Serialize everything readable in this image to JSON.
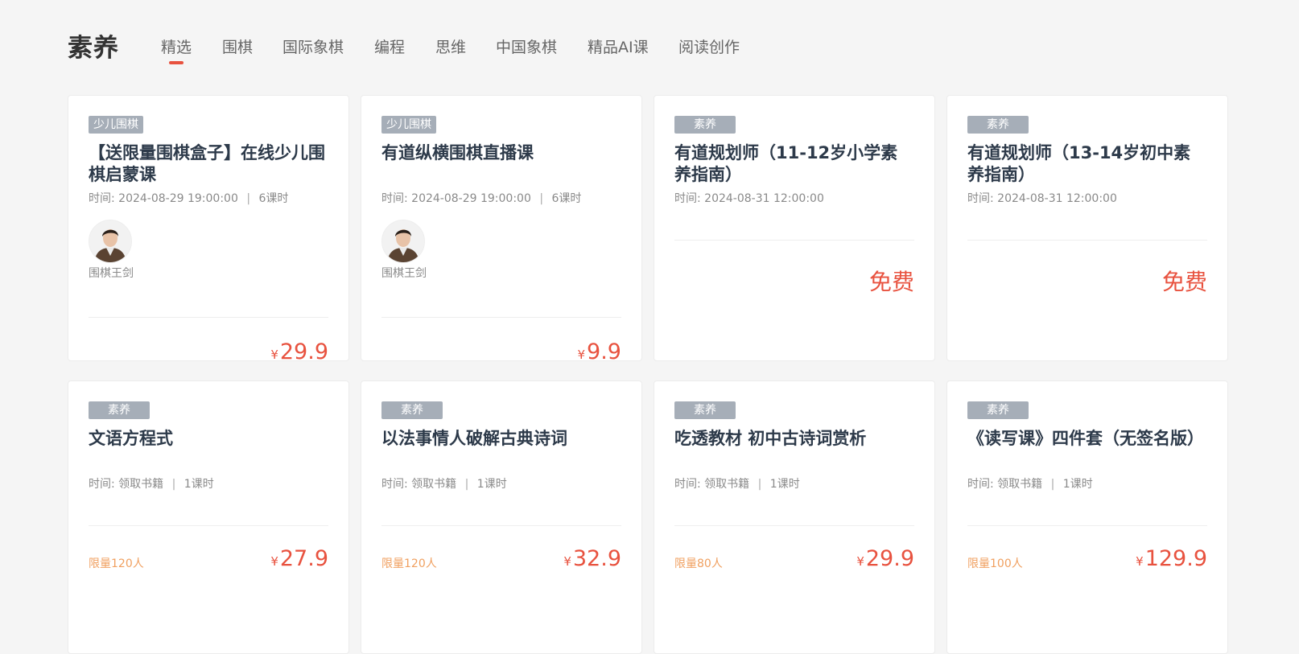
{
  "section_title": "素养",
  "tabs": [
    {
      "label": "精选",
      "active": true
    },
    {
      "label": "围棋"
    },
    {
      "label": "国际象棋"
    },
    {
      "label": "编程"
    },
    {
      "label": "思维"
    },
    {
      "label": "中国象棋"
    },
    {
      "label": "精品AI课"
    },
    {
      "label": "阅读创作"
    }
  ],
  "colors": {
    "accent": "#e8523f",
    "tag_bg": "#a6aeb8",
    "limit": "#f0a060"
  },
  "currency": "¥",
  "time_prefix": "时间:",
  "separator": "|",
  "cards": [
    {
      "tag": "少儿围棋",
      "title": "【送限量围棋盒子】在线少儿围棋启蒙课",
      "time": "2024-08-29 19:00:00",
      "lessons": "6课时",
      "teacher": "围棋王剑",
      "price": "29.9"
    },
    {
      "tag": "少儿围棋",
      "title": "有道纵横围棋直播课",
      "time": "2024-08-29 19:00:00",
      "lessons": "6课时",
      "teacher": "围棋王剑",
      "price": "9.9"
    },
    {
      "tag": "素养",
      "title": "有道规划师（11-12岁小学素养指南）",
      "time": "2024-08-31 12:00:00",
      "free": "免费"
    },
    {
      "tag": "素养",
      "title": "有道规划师（13-14岁初中素养指南）",
      "time": "2024-08-31 12:00:00",
      "free": "免费"
    },
    {
      "tag": "素养",
      "title": "文语方程式",
      "time": "领取书籍",
      "lessons": "1课时",
      "limit": "限量120人",
      "price": "27.9"
    },
    {
      "tag": "素养",
      "title": "以法事情人破解古典诗词",
      "time": "领取书籍",
      "lessons": "1课时",
      "limit": "限量120人",
      "price": "32.9"
    },
    {
      "tag": "素养",
      "title": "吃透教材 初中古诗词赏析",
      "time": "领取书籍",
      "lessons": "1课时",
      "limit": "限量80人",
      "price": "29.9"
    },
    {
      "tag": "素养",
      "title": "《读写课》四件套（无签名版）",
      "time": "领取书籍",
      "lessons": "1课时",
      "limit": "限量100人",
      "price": "129.9"
    }
  ]
}
